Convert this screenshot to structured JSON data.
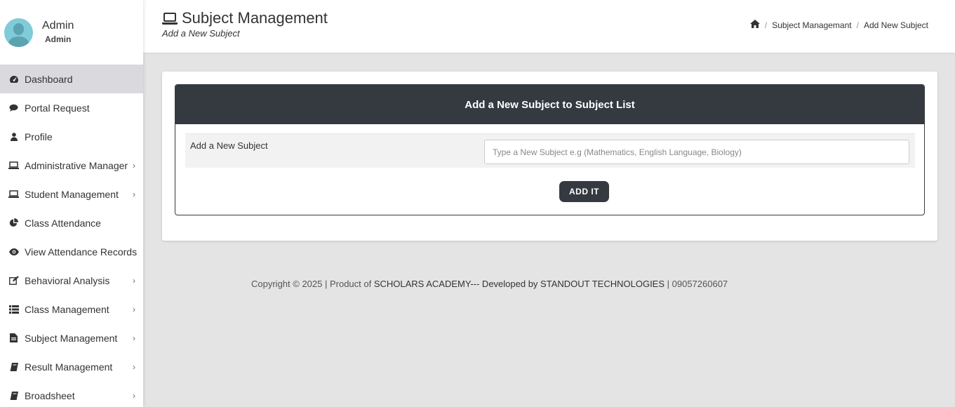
{
  "user": {
    "name": "Admin",
    "role": "Admin"
  },
  "sidebar": {
    "items": [
      {
        "label": "Dashboard",
        "icon": "dashboard-icon",
        "active": true,
        "has_children": false
      },
      {
        "label": "Portal Request",
        "icon": "comment-icon",
        "active": false,
        "has_children": false
      },
      {
        "label": "Profile",
        "icon": "user-icon",
        "active": false,
        "has_children": false
      },
      {
        "label": "Administrative Manager",
        "icon": "laptop-icon",
        "active": false,
        "has_children": true
      },
      {
        "label": "Student Management",
        "icon": "laptop-icon",
        "active": false,
        "has_children": true
      },
      {
        "label": "Class Attendance",
        "icon": "pie-chart-icon",
        "active": false,
        "has_children": false
      },
      {
        "label": "View Attendance Records",
        "icon": "eye-icon",
        "active": false,
        "has_children": false
      },
      {
        "label": "Behavioral Analysis",
        "icon": "edit-icon",
        "active": false,
        "has_children": true
      },
      {
        "label": "Class Management",
        "icon": "list-icon",
        "active": false,
        "has_children": true
      },
      {
        "label": "Subject Management",
        "icon": "file-icon",
        "active": false,
        "has_children": true
      },
      {
        "label": "Result Management",
        "icon": "book-icon",
        "active": false,
        "has_children": true
      },
      {
        "label": "Broadsheet",
        "icon": "book-icon",
        "active": false,
        "has_children": true
      }
    ]
  },
  "header": {
    "title": "Subject Management",
    "subtitle": "Add a New Subject",
    "breadcrumb": [
      "Subject Managemant",
      "Add New Subject"
    ]
  },
  "form": {
    "heading": "Add a New Subject to Subject List",
    "label": "Add a New Subject",
    "input_value": "",
    "placeholder": "Type a New Subject e.g (Mathematics, English Language, Biology)",
    "button_label": "ADD IT"
  },
  "footer": {
    "prefix": "Copyright © 2025 | Product of ",
    "org": "SCHOLARS ACADEMY--- Developed by STANDOUT TECHNOLOGIES",
    "suffix": " | 09057260607"
  },
  "colors": {
    "dark": "#343a40",
    "active_bg": "#d9d9de",
    "page_bg": "#e4e4e4"
  }
}
